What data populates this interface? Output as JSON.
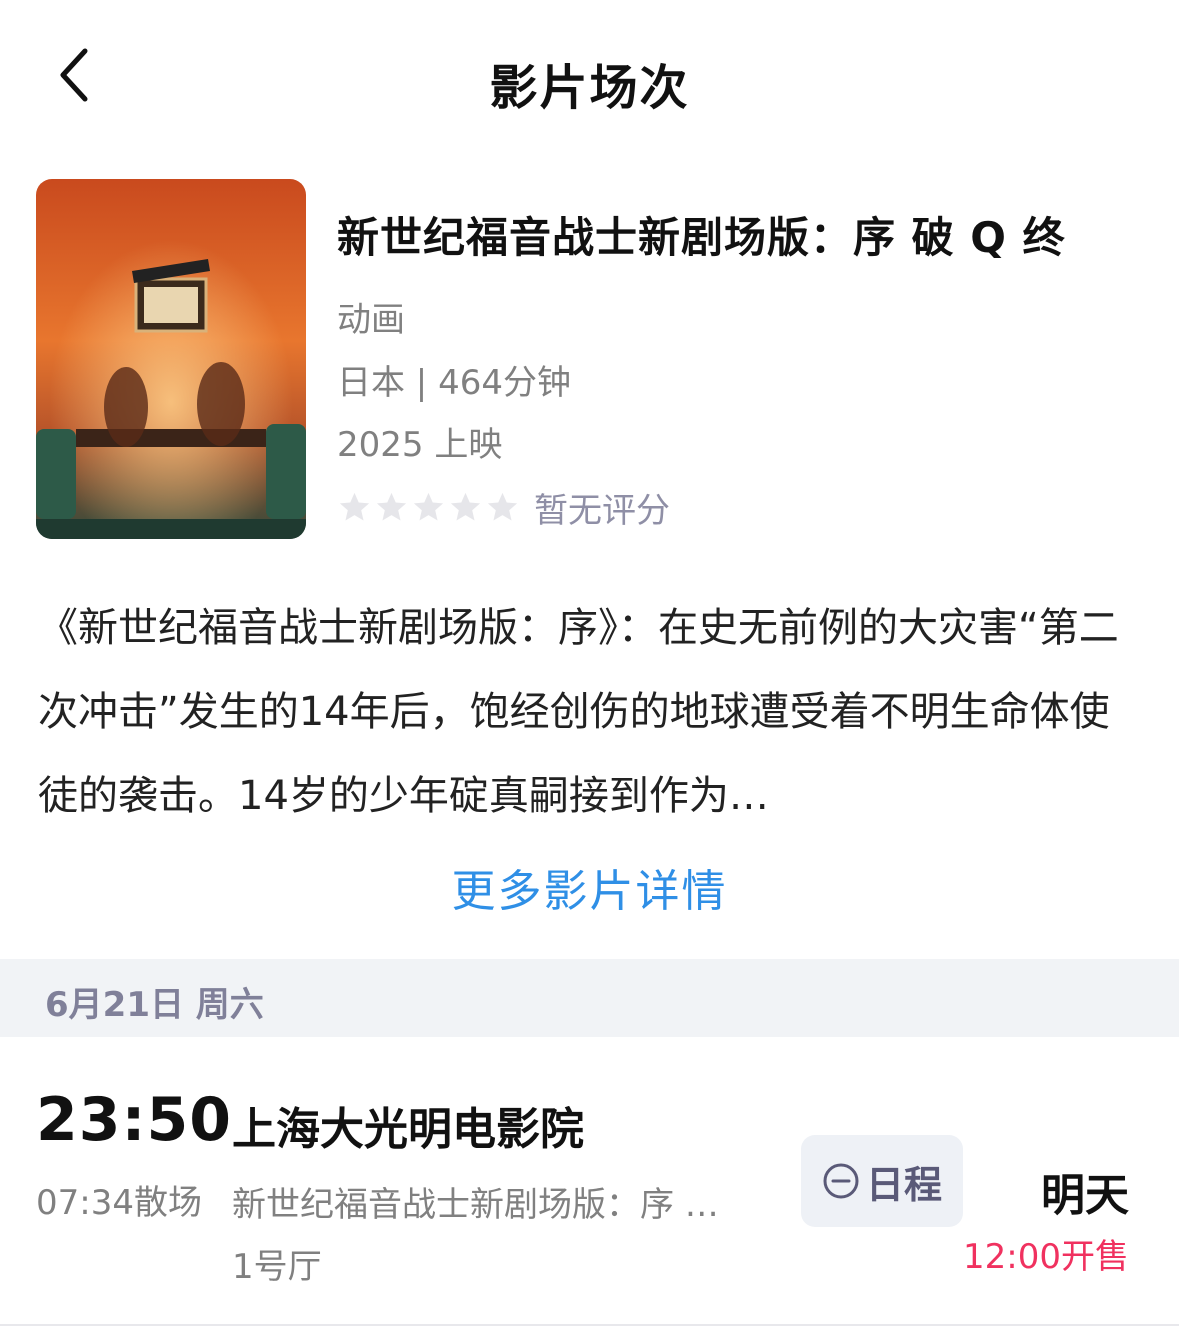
{
  "nav": {
    "back_icon": "chevron-left-icon",
    "title": "影片场次"
  },
  "movie": {
    "poster_icon": "movie-poster-image",
    "title": "新世纪福音战士新剧场版：序 破 Q 终",
    "genre": "动画",
    "meta": "日本 | 464分钟",
    "release": "2025 上映",
    "rating_stars": 0,
    "rating_text": "暂无评分",
    "synopsis": "《新世纪福音战士新剧场版：序》：在史无前例的大灾害“第二次冲击”发生的14年后，饱经创伤的地球遭受着不明生命体使徒的袭击。14岁的少年碇真嗣接到作为…",
    "more_link": "更多影片详情"
  },
  "date_bar": {
    "date": "6月21日 周六"
  },
  "showtimes": [
    {
      "start": "23:50",
      "end": "07:34散场",
      "cinema": "上海大光明电影院",
      "movie": "新世纪福音战士新剧场版：序 …",
      "hall": "1号厅",
      "schedule_label": "日程",
      "schedule_icon": "minus-circle-icon",
      "sale_day": "明天",
      "sale_time": "12:00开售"
    }
  ],
  "colors": {
    "link": "#2f8fe6",
    "sale_accent": "#f0315f",
    "date_bar_bg": "#f1f3f6"
  }
}
